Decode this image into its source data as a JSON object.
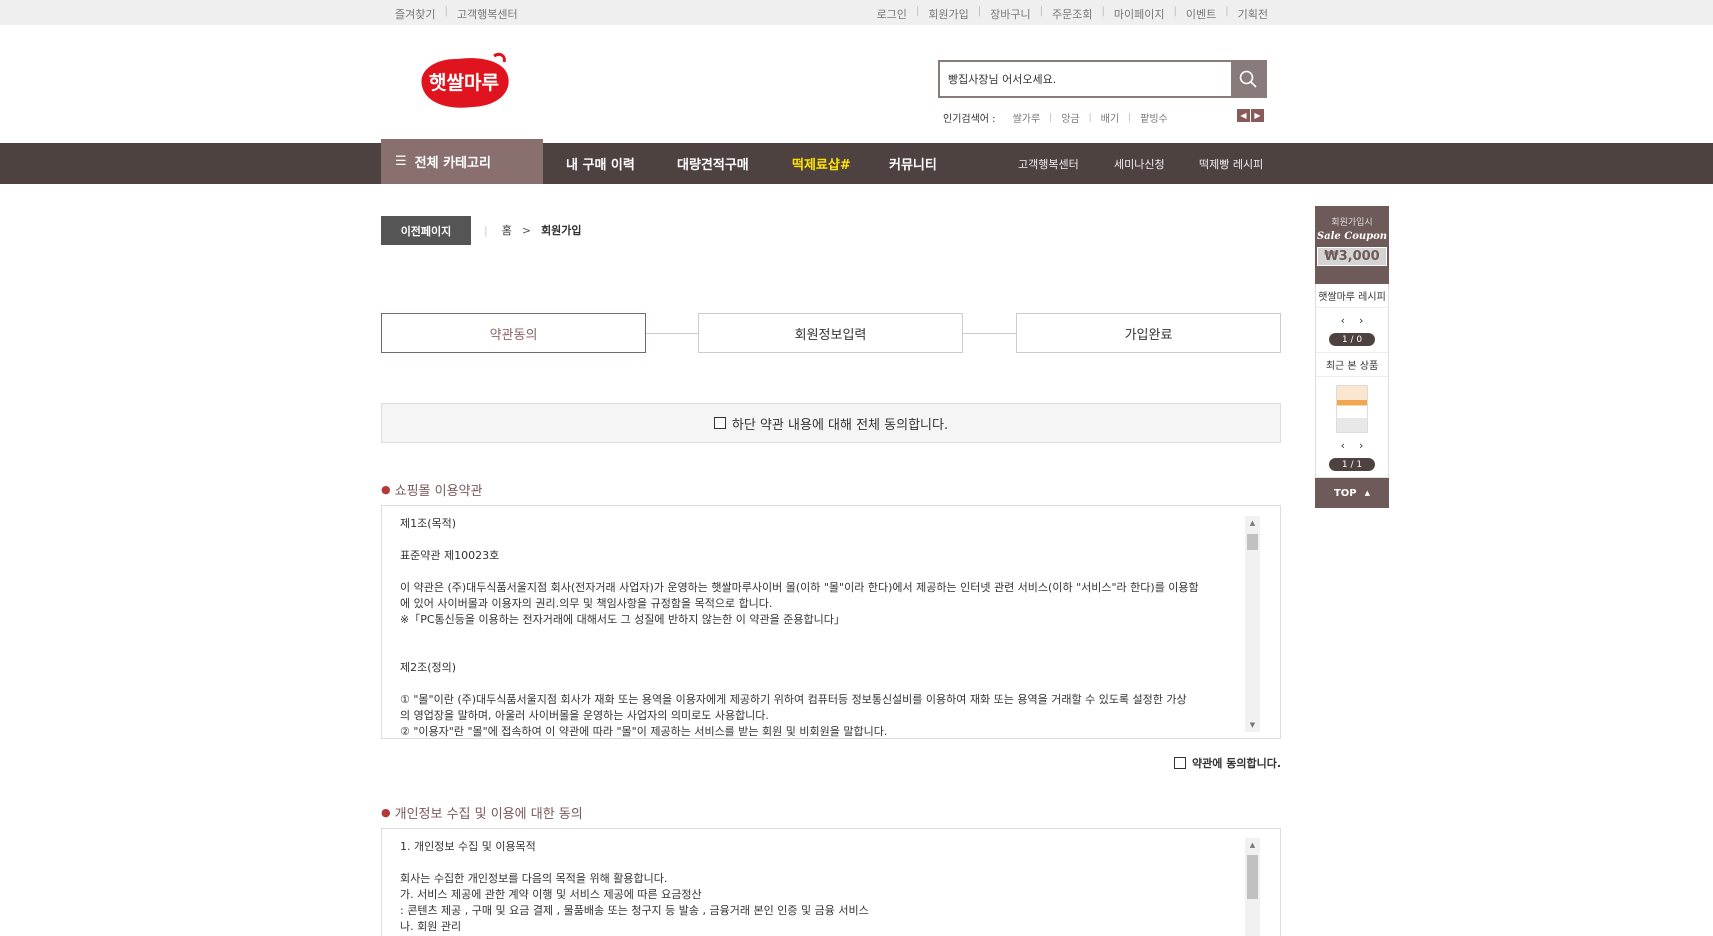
{
  "topbar": {
    "left": [
      "즐겨찾기",
      "고객행복센터"
    ],
    "right": [
      "로그인",
      "회원가입",
      "장바구니",
      "주문조회",
      "마이페이지",
      "이벤트",
      "기획전"
    ]
  },
  "header": {
    "logo_text": "햇쌀마루",
    "search_value": "빵집사장님 어서오세요.",
    "popular_label": "인기검색어 :",
    "popular_keywords": [
      "쌀가루",
      "앙금",
      "배기",
      "팥빙수"
    ]
  },
  "nav": {
    "category": "전체 카테고리",
    "main": [
      "내 구매 이력",
      "대량견적구매",
      "떡제료샵#",
      "커뮤니티"
    ],
    "sub": [
      "고객행복센터",
      "세미나신청",
      "떡제빵 레시피"
    ]
  },
  "breadcrumb": {
    "prev_button": "이전페이지",
    "home": "홈",
    "separator": ">",
    "current": "회원가입"
  },
  "steps": [
    "약관동의",
    "회원정보입력",
    "가입완료"
  ],
  "agree_all": "하단 약관 내용에 대해 전체 동의합니다.",
  "terms": {
    "title": "쇼핑몰 이용약관",
    "lines": [
      "제1조(목적)",
      "",
      "표준약관 제10023호",
      "",
      "이 약관은 (주)대두식품서울지점 회사(전자거래 사업자)가 운영하는 햇쌀마루사이버 몰(이하 \"몰\"이라 한다)에서 제공하는 인터넷 관련 서비스(이하 \"서비스\"라 한다)를 이용함",
      "에 있어 사이버몰과 이용자의 권리.의무 및 책임사항을 규정함을 목적으로 합니다.",
      "※「PC통신등을 이용하는 전자거래에 대해서도 그 성질에 반하지 않는한 이 약관을 준용합니다」",
      "",
      "",
      "제2조(정의)",
      "",
      "① \"몰\"이란 (주)대두식품서울지점 회사가 재화 또는 용역을 이용자에게 제공하기 위하여 컴퓨터등 정보통신설비를 이용하여 재화 또는 용역을 거래할 수 있도록 설정한 가상",
      "의 영업장을 말하며, 아울러 사이버몰을 운영하는 사업자의 의미로도 사용합니다.",
      "② \"이용자\"란 \"몰\"에 접속하여 이 약관에 따라 \"몰\"이 제공하는 서비스를 받는 회원 및 비회원을 말합니다."
    ],
    "agree": "약관에 동의합니다."
  },
  "privacy": {
    "title": "개인정보 수집 및 이용에 대한 동의",
    "lines": [
      "1. 개인정보 수집 및 이용목적",
      "",
      "회사는 수집한 개인정보를 다음의 목적을 위해 활용합니다.",
      "가. 서비스 제공에 관한 계약 이행 및 서비스 제공에 따른 요금정산",
      ": 콘텐츠 제공 , 구매 및 요금 결제 , 물품배송 또는 청구지 등 발송 , 금융거래 본인 인증 및 금융 서비스",
      "나. 회원 관리"
    ]
  },
  "quick": {
    "coupon_line1": "회원가입시",
    "coupon_line2": "Sale Coupon",
    "coupon_amount": "₩3,000",
    "recipe_title": "햇쌀마루 레시피",
    "recipe_count": "1 / 0",
    "recent_title": "최근 본 상품",
    "recent_count": "1 / 1",
    "top_label": "TOP"
  },
  "colors": {
    "nav_bg": "#4e4241",
    "category_bg": "#8a6f6f",
    "highlight": "#ffe400",
    "accent": "#8a6464",
    "logo_red": "#e0141e"
  }
}
